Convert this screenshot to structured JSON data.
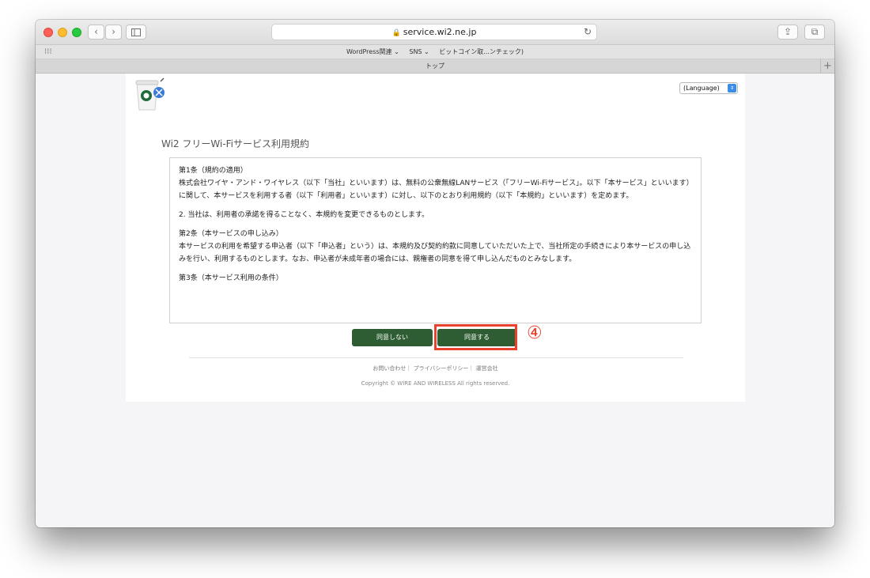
{
  "browser": {
    "url": "service.wi2.ne.jp",
    "bookmarks": [
      "WordPress関連 ⌄",
      "SNS ⌄",
      "ビットコイン取...ンチェック)"
    ],
    "tab_title": "トップ"
  },
  "page": {
    "language_select": "(Language)",
    "title": "Wi2 フリーWi-Fiサービス利用規約",
    "terms": [
      {
        "heading": "第1条（規約の適用）",
        "body": "株式会社ワイヤ・アンド・ワイヤレス（以下「当社」といいます）は、無料の公衆無線LANサービス（「フリーWi-Fiサービス」。以下「本サービス」といいます）に関して、本サービスを利用する者（以下「利用者」といいます）に対し、以下のとおり利用規約（以下「本規約」といいます）を定めます。"
      },
      {
        "heading": "",
        "body": "2. 当社は、利用者の承諾を得ることなく、本規約を変更できるものとします。"
      },
      {
        "heading": "第2条（本サービスの申し込み）",
        "body": "本サービスの利用を希望する申込者（以下「申込者」という）は、本規約及び契約約款に同意していただいた上で、当社所定の手続きにより本サービスの申し込みを行い、利用するものとします。なお、申込者が未成年者の場合には、親権者の同意を得て申し込んだものとみなします。"
      },
      {
        "heading": "第3条（本サービス利用の条件）",
        "body": ""
      }
    ],
    "disagree_label": "同意しない",
    "agree_label": "同意する",
    "step_marker": "④",
    "footer_links": "お問い合わせ｜ プライバシーポリシー｜ 運営会社",
    "copyright": "Copyright © WIRE AND WIRELESS All rights reserved."
  },
  "colors": {
    "button_green": "#2e5d33",
    "highlight_red": "#e8412e"
  }
}
